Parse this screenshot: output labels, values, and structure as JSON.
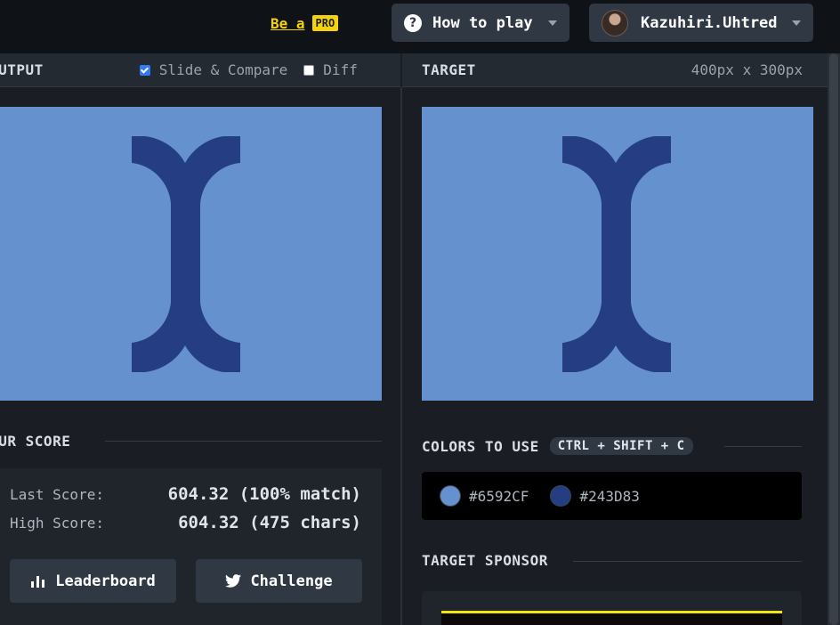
{
  "topbar": {
    "pro_text": "Be a",
    "pro_badge": "PRO",
    "how_to_play": "How to play",
    "username": "Kazuhiri.Uhtred"
  },
  "output_panel": {
    "title": "OUTPUT",
    "slide_compare_label": "Slide & Compare",
    "slide_compare_checked": true,
    "diff_label": "Diff",
    "diff_checked": false
  },
  "target_panel": {
    "title": "TARGET",
    "dimensions": "400px x 300px"
  },
  "score": {
    "title": "YOUR SCORE",
    "last_label": "Last Score:",
    "last_value": "604.32 (100% match)",
    "high_label": "High Score:",
    "high_value": "604.32 (475 chars)",
    "leaderboard_label": "Leaderboard",
    "challenge_label": "Challenge"
  },
  "colors": {
    "title": "COLORS TO USE",
    "shortcut": "CTRL + SHIFT + C",
    "items": [
      {
        "hex": "#6592CF",
        "color": "#6592cf"
      },
      {
        "hex": "#243D83",
        "color": "#243d83"
      }
    ]
  },
  "sponsor": {
    "title": "TARGET SPONSOR"
  },
  "icons": {
    "help": "help-circle-icon",
    "dropdown": "chevron-down-icon",
    "leaderboard": "bar-chart-icon",
    "challenge": "twitter-icon"
  }
}
